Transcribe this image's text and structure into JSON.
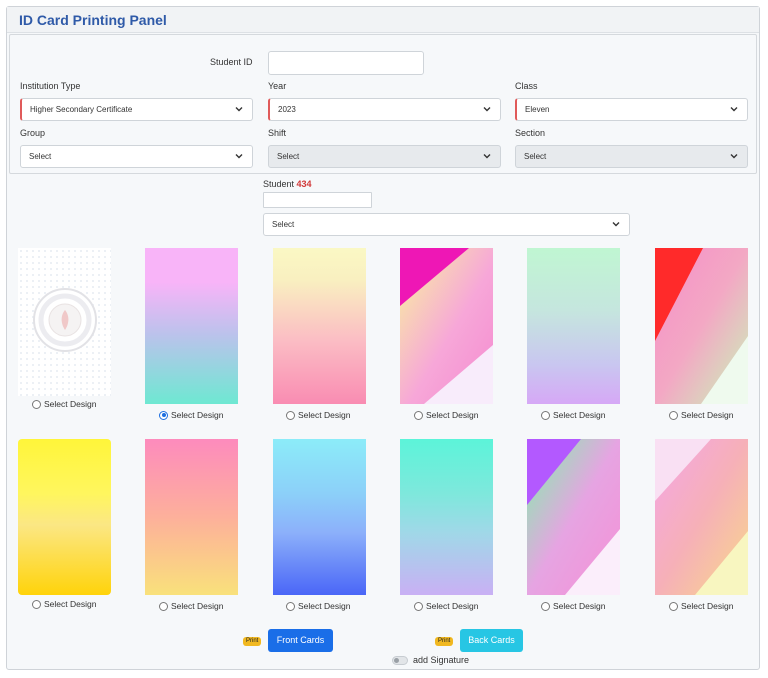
{
  "panel": {
    "title": "ID Card Printing Panel"
  },
  "form": {
    "student_id": {
      "label": "Student ID",
      "value": ""
    },
    "institution_type": {
      "label": "Institution Type",
      "value": "Higher Secondary Certificate"
    },
    "year": {
      "label": "Year",
      "value": "2023"
    },
    "class": {
      "label": "Class",
      "value": "Eleven"
    },
    "group": {
      "label": "Group",
      "value": "Select"
    },
    "shift": {
      "label": "Shift",
      "value": "Select"
    },
    "section": {
      "label": "Section",
      "value": "Select"
    }
  },
  "student_filter": {
    "label": "Student",
    "count": "434",
    "search_value": "",
    "select_value": "Select"
  },
  "designs": {
    "option_label": "Select Design",
    "selected_index": 1,
    "items": [
      {
        "name": "design-1",
        "kind": "watermark"
      },
      {
        "name": "design-2",
        "kind": "gradient",
        "colors": [
          "#f8b4f8",
          "#bcc2ec",
          "#6ee8d2"
        ]
      },
      {
        "name": "design-3",
        "kind": "gradient",
        "colors": [
          "#faf8c4",
          "#fbbcc4",
          "#f98cb2"
        ]
      },
      {
        "name": "design-4",
        "kind": "diagonal",
        "accent": "#ee17b5"
      },
      {
        "name": "design-5",
        "kind": "gradient",
        "colors": [
          "#c0f6d2",
          "#c9c6f0",
          "#d6a8f6"
        ]
      },
      {
        "name": "design-6",
        "kind": "diagonal",
        "accent": "#ff2a2a"
      },
      {
        "name": "design-7",
        "kind": "gradient",
        "colors": [
          "#fff53a",
          "#fbe784",
          "#ffd30a"
        ]
      },
      {
        "name": "design-8",
        "kind": "gradient",
        "colors": [
          "#fd8bbd",
          "#fdb09b",
          "#f9e17b"
        ]
      },
      {
        "name": "design-9",
        "kind": "gradient",
        "colors": [
          "#8cecf9",
          "#8cb0fa",
          "#4a66f7"
        ]
      },
      {
        "name": "design-10",
        "kind": "gradient",
        "colors": [
          "#5cf4d9",
          "#a0d8e8",
          "#c9b0f4"
        ]
      },
      {
        "name": "design-11",
        "kind": "diagonal",
        "accent": "#b359ff"
      },
      {
        "name": "design-12",
        "kind": "diagonal",
        "accent": "#f7c8f0"
      }
    ]
  },
  "actions": {
    "print_badge": "Print",
    "front_button": "Front Cards",
    "back_button": "Back Cards",
    "signature_label": "add Signature"
  },
  "colors": {
    "title": "#2f5aa8",
    "primary": "#1a6ee8",
    "info": "#27c6e4",
    "warning": "#f1b820",
    "danger": "#d13838"
  }
}
